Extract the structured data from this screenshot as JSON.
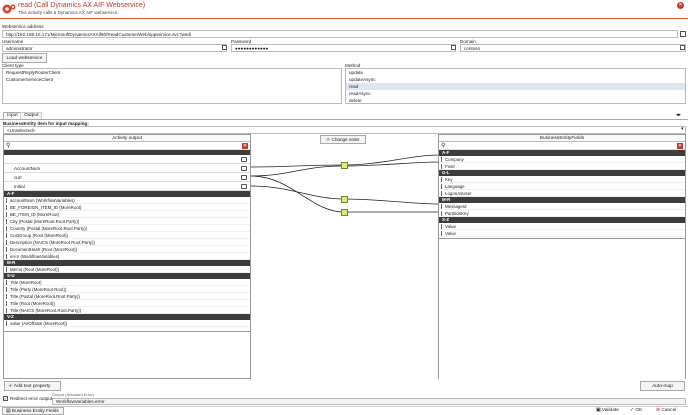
{
  "header": {
    "title": "read (Call Dynamics AX AIF Webservice)",
    "subtitle": "This activity calls a Dynamics AX AIF webservice."
  },
  "ws": {
    "label": "Webservice address",
    "value": "http://192.168.10.171/MicrosoftDynamicsAXAif60/ReadCustomerWeb/xppservice.svc?wsdl"
  },
  "creds": {
    "username_label": "Username",
    "username": "administrator",
    "password_label": "Password",
    "password": "●●●●●●●●●●●●",
    "domain_label": "Domain",
    "domain": "contoso"
  },
  "load_label": "Load webservice",
  "client_type": {
    "label": "Client type",
    "items": [
      "RequestReplyRouterClient",
      "CustomerServiceClient"
    ]
  },
  "method": {
    "label": "Method",
    "items": [
      "update",
      "updateAsync",
      "read",
      "readAsync",
      "delete"
    ],
    "selected": 2
  },
  "tabs": [
    "Input",
    "Output"
  ],
  "entity": {
    "label": "BusinessEntity item for input mapping:",
    "value": "<Unselected>"
  },
  "left": {
    "title": "Activity output",
    "tree": [
      "",
      "AccountNum",
      "curr",
      "Initial"
    ],
    "sections": [
      {
        "header": "A-F",
        "rows": [
          "accountNum (WorkflowVariables)",
          "BE_FOREIGN_ITEM_ID (MoreRoot)",
          "BE_ITEM_ID (MoreRoot)",
          "City (Postal (MoreRoot.Root.Party))",
          "Country (Postal (MoreRoot.Root.Party))",
          "CustGroup (Root (MoreRoot))",
          "Description (NAICS (MoreRoot.Root.Party))",
          "DocumentHash (Root (MoreRoot))",
          "error (WorkflowVariables)"
        ]
      },
      {
        "header": "M-R",
        "rows": [
          "Memo (Root (MoreRoot))"
        ]
      },
      {
        "header": "S-U",
        "rows": [
          "Title (MoreRoot)",
          "Title (Party (MoreRoot.Root))",
          "Title (Postal (MoreRoot.Root.Party))",
          "Title (Root (MoreRoot))",
          "Title (NAICS (MoreRoot.Root.Party))"
        ]
      },
      {
        "header": "V-Z",
        "rows": [
          "value (AsOfDate (MoreRoot))"
        ]
      }
    ]
  },
  "right": {
    "title": "BusinessEntityFields",
    "sections": [
      {
        "header": "A-F",
        "rows": [
          "Company",
          "Field"
        ]
      },
      {
        "header": "G-L",
        "rows": [
          "Key",
          "Language",
          "LogonAsUser"
        ]
      },
      {
        "header": "M-R",
        "rows": [
          "MessageId",
          "PartitionKey"
        ]
      },
      {
        "header": "S-Z",
        "rows": [
          "Value",
          "Value"
        ]
      }
    ]
  },
  "change_order": "Change order",
  "add_text": "Add text property",
  "automap": "Auto-map",
  "redirect": {
    "label": "Redirect error output",
    "out_label": "Output (Standard Error):",
    "value": "WorkflowVariables.error"
  },
  "footer": {
    "bef": "Business Entity Fields",
    "validate": "Validate",
    "ok": "OK",
    "cancel": "Cancel"
  }
}
